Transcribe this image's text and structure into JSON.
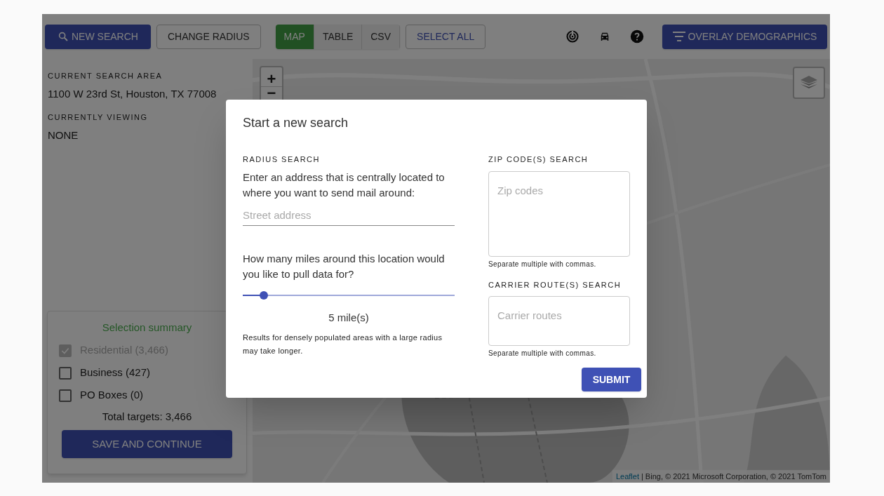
{
  "toolbar": {
    "new_search": "NEW SEARCH",
    "change_radius": "CHANGE RADIUS",
    "view_tabs": [
      {
        "label": "MAP",
        "selected": true
      },
      {
        "label": "TABLE",
        "selected": false
      },
      {
        "label": "CSV",
        "selected": false
      }
    ],
    "select_all": "SELECT ALL",
    "overlay_button": "OVERLAY DEMOGRAPHICS"
  },
  "sidebar": {
    "current_search_area": {
      "label": "CURRENT SEARCH AREA",
      "value": "1100 W 23rd St, Houston, TX 77008"
    },
    "currently_viewing": {
      "label": "CURRENTLY VIEWING",
      "value": "NONE"
    },
    "summary": {
      "title": "Selection summary",
      "options": [
        {
          "label": "Residential (3,466)",
          "checked": true,
          "disabled": true
        },
        {
          "label": "Business (427)",
          "checked": false,
          "disabled": false
        },
        {
          "label": "PO Boxes (0)",
          "checked": false,
          "disabled": false
        }
      ],
      "total": "Total targets: 3,466",
      "save_button": "SAVE AND CONTINUE"
    }
  },
  "map": {
    "zoom_in": "+",
    "zoom_out": "−",
    "attribution_link": "Leaflet",
    "attribution": "| Bing, © 2021 Microsoft Corporation, © 2021 TomTom"
  },
  "dialog": {
    "title": "Start a new search",
    "radius": {
      "heading": "RADIUS SEARCH",
      "prompt": "Enter an address that is centrally located to where you want to send mail around:",
      "address_placeholder": "Street address",
      "miles_prompt": "How many miles around this location would you like to pull data for?",
      "slider": {
        "level": 0.1
      },
      "reading": "5 mile(s)",
      "note": "Results for densely populated areas with a large radius may take longer."
    },
    "zip": {
      "heading": "ZIP CODE(S) SEARCH",
      "placeholder": "Zip codes",
      "hint": "Separate multiple with commas."
    },
    "carrier": {
      "heading": "CARRIER ROUTE(S) SEARCH",
      "placeholder": "Carrier routes",
      "hint": "Separate multiple with commas."
    },
    "submit": "SUBMIT"
  }
}
